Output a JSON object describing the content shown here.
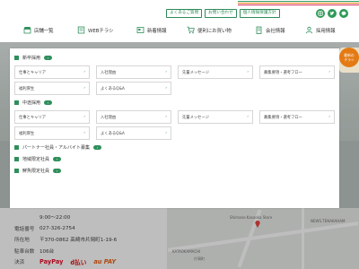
{
  "header": {
    "util_links": [
      "よくあるご質問",
      "お問い合わせ",
      "個人情報保護方針"
    ],
    "sns": [
      "instagram-icon",
      "twitter-icon",
      "line-icon"
    ],
    "nav": [
      {
        "label": "店舗一覧",
        "icon": "shop-icon"
      },
      {
        "label": "WEBチラシ",
        "icon": "flyer-icon"
      },
      {
        "label": "新着情報",
        "icon": "news-icon"
      },
      {
        "label": "便利にお買い物",
        "icon": "cart-icon"
      },
      {
        "label": "会社情報",
        "icon": "building-icon"
      },
      {
        "label": "採用情報",
        "icon": "recruit-icon"
      }
    ],
    "accent_color": "#2f8f5b"
  },
  "menu": {
    "new_grad": {
      "title": "新卒採用",
      "links": [
        "仕事とキャリア",
        "入社理由",
        "先輩メッセージ",
        "募集要項・選考フロー",
        "福利厚生",
        "よくあるQ&A"
      ]
    },
    "mid_career": {
      "title": "中途採用",
      "links": [
        "仕事とキャリア",
        "入社理由",
        "先輩メッセージ",
        "募集要項・選考フロー",
        "福利厚生",
        "よくあるQ&A"
      ]
    },
    "part_time": {
      "title": "パートナー社員・アルバイト募集"
    },
    "regional": {
      "title": "地域限定社員"
    },
    "shop_specific": {
      "title": "鮮魚限定社員"
    }
  },
  "store_info": {
    "hours_value": "9:00～22:00",
    "rows": [
      {
        "label": "電話番号",
        "value": "027-326-2754"
      },
      {
        "label": "所在地",
        "value": "〒370-0862 高崎市片岡町1-19-6"
      },
      {
        "label": "駐車台数",
        "value": "106台"
      }
    ],
    "payment_label": "決済",
    "payments": [
      "PayPay",
      "d払い",
      "au PAY"
    ]
  },
  "map": {
    "labels": [
      "KATAOKAMACHI",
      "片岡町",
      "Shimano Kasaoka Store",
      "NEWS.TENAKAHAM"
    ]
  },
  "fab": {
    "line1": "最新の",
    "line2": "チラシ"
  }
}
